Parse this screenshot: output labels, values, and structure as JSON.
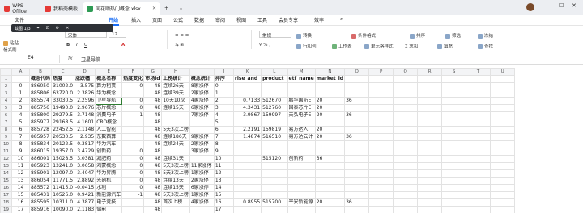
{
  "titlebar": {
    "app_label": "WPS Office",
    "tab1_label": "我稻壳模板",
    "tab2_label": "同花顺热门概念.xlsx",
    "new_tab": "+",
    "more": "⌄"
  },
  "menu": {
    "items": [
      "文件",
      "开始",
      "插入",
      "页面",
      "公式",
      "数据",
      "审阅",
      "视图",
      "工具",
      "会员专享",
      "效率"
    ],
    "active_index": 1
  },
  "floatbar": {
    "label": "截图 1/3"
  },
  "ribbon": {
    "paste": "粘贴",
    "format_painter": "格式刷",
    "font": "宋体",
    "font_size": "12",
    "number_format": "常规",
    "convert": "转换",
    "row_col": "行和列",
    "worksheet": "工作表",
    "sort": "排序",
    "freeze": "冻结",
    "filter": "筛选",
    "find": "查找",
    "sum": "求和",
    "fill": "填充",
    "cond_format": "条件格式",
    "style": "单元格样式"
  },
  "formula": {
    "cell_ref": "E4",
    "fx": "fx",
    "value": "卫星导航"
  },
  "columns": [
    "A",
    "B",
    "C",
    "D",
    "E",
    "F",
    "G",
    "H",
    "I",
    "J",
    "K",
    "L",
    "M",
    "N",
    "O",
    "P",
    "Q",
    "R",
    "S",
    "T",
    "U"
  ],
  "rows": [
    [
      "",
      "概念代码",
      "热度",
      "涨跌幅",
      "概念名称",
      "热度变化",
      "市场id",
      "上榜统计",
      "概念统计",
      "排序",
      "rise_and_",
      "product_",
      "etf_name",
      "market_id",
      "",
      "",
      "",
      "",
      "",
      "",
      ""
    ],
    [
      "0",
      "886050",
      "31002.0",
      "3.575",
      "算力租赁",
      "0",
      "48",
      "连续26天",
      "8家涨停",
      "0",
      "",
      "",
      "",
      "",
      "",
      "",
      "",
      "",
      "",
      "",
      ""
    ],
    [
      "1",
      "885806",
      "63720.0",
      "2.3826",
      "华为概念",
      "",
      "48",
      "连续39天",
      "2家涨停",
      "1",
      "",
      "",
      "",
      "",
      "",
      "",
      "",
      "",
      "",
      "",
      ""
    ],
    [
      "2",
      "885574",
      "33030.5",
      "2.2596",
      "卫星导航",
      "0",
      "48",
      "10天10次",
      "4家涨停",
      "2",
      "0.7133",
      "512670",
      "鹏华国防E",
      "20",
      "36",
      "",
      "",
      "",
      "",
      "",
      ""
    ],
    [
      "3",
      "885756",
      "19490.0",
      "2.9676",
      "芯片概念",
      "0",
      "48",
      "连续15天",
      "6家涨停",
      "3",
      "4.3431",
      "512760",
      "国泰芯片E",
      "20",
      "",
      "",
      "",
      "",
      "",
      "",
      ""
    ],
    [
      "4",
      "885800",
      "29279.5",
      "3.7148",
      "消费电子",
      "-1",
      "48",
      "",
      "7家涨停",
      "4",
      "3.9867",
      "159997",
      "天弘电子E",
      "20",
      "36",
      "",
      "",
      "",
      "",
      "",
      ""
    ],
    [
      "5",
      "885977",
      "29168.5",
      "4.1601",
      "CRO概念",
      "",
      "48",
      "",
      "",
      "5",
      "",
      "",
      "",
      "",
      "",
      "",
      "",
      "",
      "",
      "",
      ""
    ],
    [
      "6",
      "885728",
      "22452.5",
      "2.1148",
      "人工智能",
      "",
      "48",
      "5天3次上榜",
      "",
      "6",
      "2.2191",
      "159819",
      "易方达人",
      "20",
      "",
      "",
      "",
      "",
      "",
      "",
      ""
    ],
    [
      "7",
      "885957",
      "20530.5",
      "2.935",
      "东数西算",
      "",
      "48",
      "连续186天",
      "9家涨停",
      "7",
      "1.4874",
      "516510",
      "易方达云计",
      "20",
      "36",
      "",
      "",
      "",
      "",
      "",
      ""
    ],
    [
      "8",
      "885834",
      "20122.5",
      "0.3817",
      "华为汽车",
      "",
      "48",
      "连续24天",
      "2家涨停",
      "8",
      "",
      "",
      "",
      "",
      "",
      "",
      "",
      "",
      "",
      "",
      ""
    ],
    [
      "9",
      "886015",
      "19357.0",
      "3.4729",
      "创新药",
      "0",
      "48",
      "",
      "3家涨停",
      "9",
      "",
      "",
      "",
      "",
      "",
      "",
      "",
      "",
      "",
      "",
      ""
    ],
    [
      "10",
      "886001",
      "15028.5",
      "3.0381",
      "减肥药",
      "0",
      "48",
      "连续31天",
      "",
      "10",
      "",
      "515120",
      "创新药",
      "36",
      "",
      "",
      "",
      "",
      "",
      "",
      ""
    ],
    [
      "11",
      "885923",
      "13241.0",
      "3.0658",
      "鸿蒙概念",
      "0",
      "48",
      "5天3次上榜",
      "11家涨停",
      "11",
      "",
      "",
      "",
      "",
      "",
      "",
      "",
      "",
      "",
      "",
      ""
    ],
    [
      "12",
      "885901",
      "12097.0",
      "3.4047",
      "华为昇腾",
      "0",
      "48",
      "5天3次上榜",
      "1家涨停",
      "12",
      "",
      "",
      "",
      "",
      "",
      "",
      "",
      "",
      "",
      "",
      ""
    ],
    [
      "13",
      "886054",
      "11771.5",
      "2.8892",
      "光刻机",
      "0",
      "48",
      "连续13天",
      "2家涨停",
      "13",
      "",
      "",
      "",
      "",
      "",
      "",
      "",
      "",
      "",
      "",
      ""
    ],
    [
      "14",
      "885572",
      "11415.0",
      "-0.0415",
      "水利",
      "0",
      "48",
      "连续15天",
      "6家涨停",
      "14",
      "",
      "",
      "",
      "",
      "",
      "",
      "",
      "",
      "",
      "",
      ""
    ],
    [
      "15",
      "885431",
      "10526.0",
      "0.9421",
      "新能源汽车",
      "-1",
      "48",
      "5天3次上榜",
      "1家涨停",
      "15",
      "",
      "",
      "",
      "",
      "",
      "",
      "",
      "",
      "",
      "",
      ""
    ],
    [
      "16",
      "885595",
      "10311.0",
      "4.3877",
      "电子竞技",
      "",
      "48",
      "首次上榜",
      "4家涨停",
      "16",
      "0.8955",
      "515700",
      "平安新能源",
      "20",
      "36",
      "",
      "",
      "",
      "",
      "",
      ""
    ],
    [
      "17",
      "885916",
      "10090.0",
      "2.1183",
      "储能",
      "",
      "48",
      "",
      "",
      "17",
      "",
      "",
      "",
      "",
      "",
      "",
      "",
      "",
      "",
      "",
      ""
    ]
  ]
}
